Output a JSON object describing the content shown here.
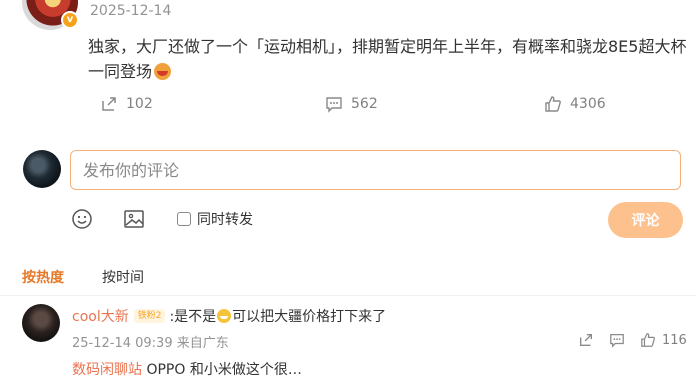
{
  "post": {
    "date": "2025-12-14",
    "vip_badge": "v",
    "text": "独家，大厂还做了一个「运动相机」，排期暂定明年上半年，有概率和骁龙8E5超大杯一同登场",
    "emoji": "smiling-face-emoji",
    "actions": {
      "forward_count": "102",
      "comment_count": "562",
      "like_count": "4306"
    }
  },
  "composer": {
    "placeholder": "发布你的评论",
    "sync_forward_label": "同时转发",
    "submit_label": "评论"
  },
  "tabs": {
    "hot": "按热度",
    "time": "按时间"
  },
  "comments": [
    {
      "name": "cool大新",
      "level_badge": "铁粉2",
      "text_before": ":是不是",
      "emoji": "grinning-sweat-emoji",
      "text_after": "可以把大疆价格打下来了",
      "time": "25-12-14 09:39",
      "location": "来自广东",
      "like_count": "116"
    }
  ],
  "next_comment_partial": {
    "name": "数码闲聊站",
    "text": "OPPO 和小米做这个很…"
  },
  "colors": {
    "accent": "#e6792a",
    "name": "#eb7350",
    "submit_disabled": "#fdc18e",
    "input_border": "#f7b178"
  }
}
